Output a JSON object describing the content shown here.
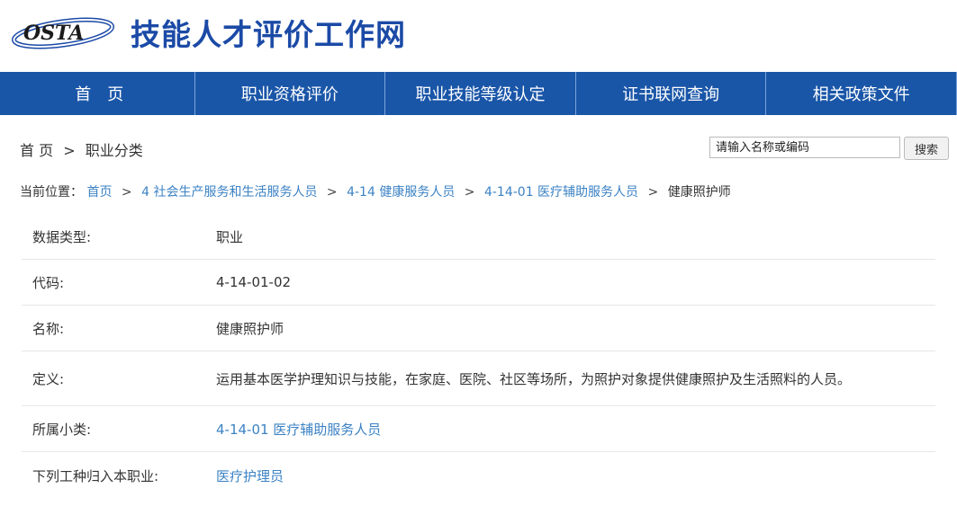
{
  "header": {
    "logo_text": "OSTA",
    "site_title": "技能人才评价工作网",
    "colors": {
      "brand": "#1b4aa6",
      "nav": "#1a56a8",
      "link": "#3b82c4"
    }
  },
  "nav": {
    "items": [
      {
        "label": "首　页"
      },
      {
        "label": "职业资格评价"
      },
      {
        "label": "职业技能等级认定"
      },
      {
        "label": "证书联网查询"
      },
      {
        "label": "相关政策文件"
      }
    ]
  },
  "breadcrumb": {
    "home": "首 页",
    "separator": ">",
    "current": "职业分类"
  },
  "search": {
    "placeholder": "请输入名称或编码",
    "button_label": "搜索"
  },
  "position": {
    "label": "当前位置：",
    "separator": ">",
    "links": [
      "首页",
      "4 社会生产服务和生活服务人员",
      "4-14 健康服务人员",
      "4-14-01 医疗辅助服务人员"
    ],
    "current": "健康照护师"
  },
  "details": [
    {
      "label": "数据类型:",
      "value": "职业"
    },
    {
      "label": "代码:",
      "value": "4-14-01-02"
    },
    {
      "label": "名称:",
      "value": "健康照护师"
    },
    {
      "label": "定义:",
      "value": "运用基本医学护理知识与技能，在家庭、医院、社区等场所，为照护对象提供健康照护及生活照料的人员。"
    },
    {
      "label": "所属小类:",
      "value": "4-14-01 医疗辅助服务人员"
    },
    {
      "label": "下列工种归入本职业:",
      "value": "医疗护理员"
    }
  ]
}
